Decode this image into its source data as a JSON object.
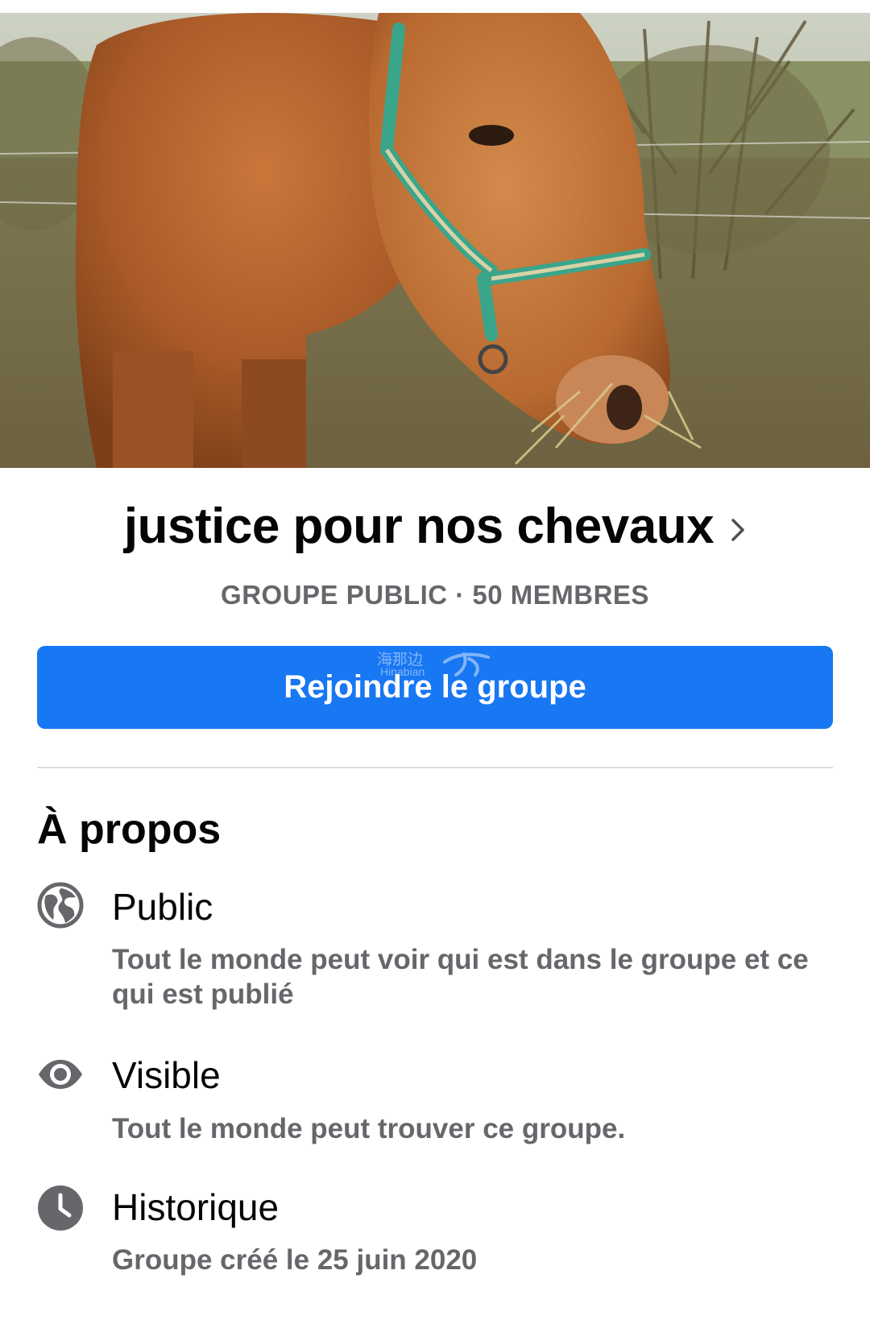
{
  "group": {
    "name": "justice pour nos chevaux",
    "meta": "GROUPE PUBLIC · 50 MEMBRES",
    "join_label": "Rejoindre le groupe"
  },
  "watermark": {
    "cn": "海那边",
    "en": "Hinabian"
  },
  "about": {
    "title": "À propos",
    "items": [
      {
        "icon": "globe-icon",
        "title": "Public",
        "desc": "Tout le monde peut voir qui est dans le groupe et ce qui est publié"
      },
      {
        "icon": "eye-icon",
        "title": "Visible",
        "desc": "Tout le monde peut trouver ce groupe."
      },
      {
        "icon": "clock-icon",
        "title": "Historique",
        "desc": "Groupe créé le 25 juin 2020"
      }
    ]
  },
  "colors": {
    "accent": "#1877f2",
    "secondary_text": "#65676b",
    "divider": "#dddfe2"
  }
}
